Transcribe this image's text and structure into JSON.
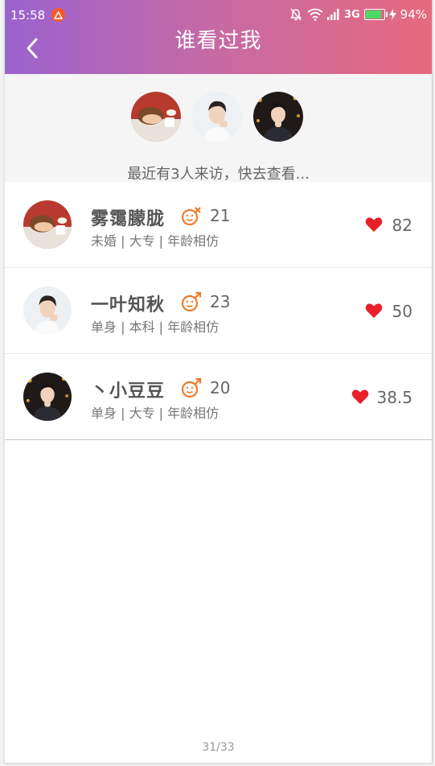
{
  "status_bar": {
    "time": "15:58",
    "network": "3G",
    "battery": "94%",
    "battery_level": 0.94,
    "icons": [
      "alert-icon",
      "bell-muted-icon",
      "wifi-icon",
      "signal-icon",
      "charging-icon"
    ]
  },
  "header": {
    "title": "谁看过我",
    "back_icon": "chevron-left-icon"
  },
  "visitors": {
    "summary": "最近有3人来访，快去查看..."
  },
  "list": [
    {
      "name": "雾霭朦胧",
      "gender_icon": "male-symbol-icon",
      "age": "21",
      "tags": "未婚 | 大专 | 年龄相仿",
      "score": "82"
    },
    {
      "name": "一叶知秋",
      "gender_icon": "male-symbol-icon",
      "age": "23",
      "tags": "单身 | 本科 | 年龄相仿",
      "score": "50"
    },
    {
      "name": "丶小豆豆",
      "gender_icon": "male-symbol-icon",
      "age": "20",
      "tags": "单身 | 大专 | 年龄相仿",
      "score": "38.5"
    }
  ],
  "footer": {
    "page_indicator": "31/33"
  },
  "colors": {
    "gradient_start": "#9b62cf",
    "gradient_end": "#e66a7e",
    "heart": "#e8202a",
    "gender": "#f07a2a"
  }
}
